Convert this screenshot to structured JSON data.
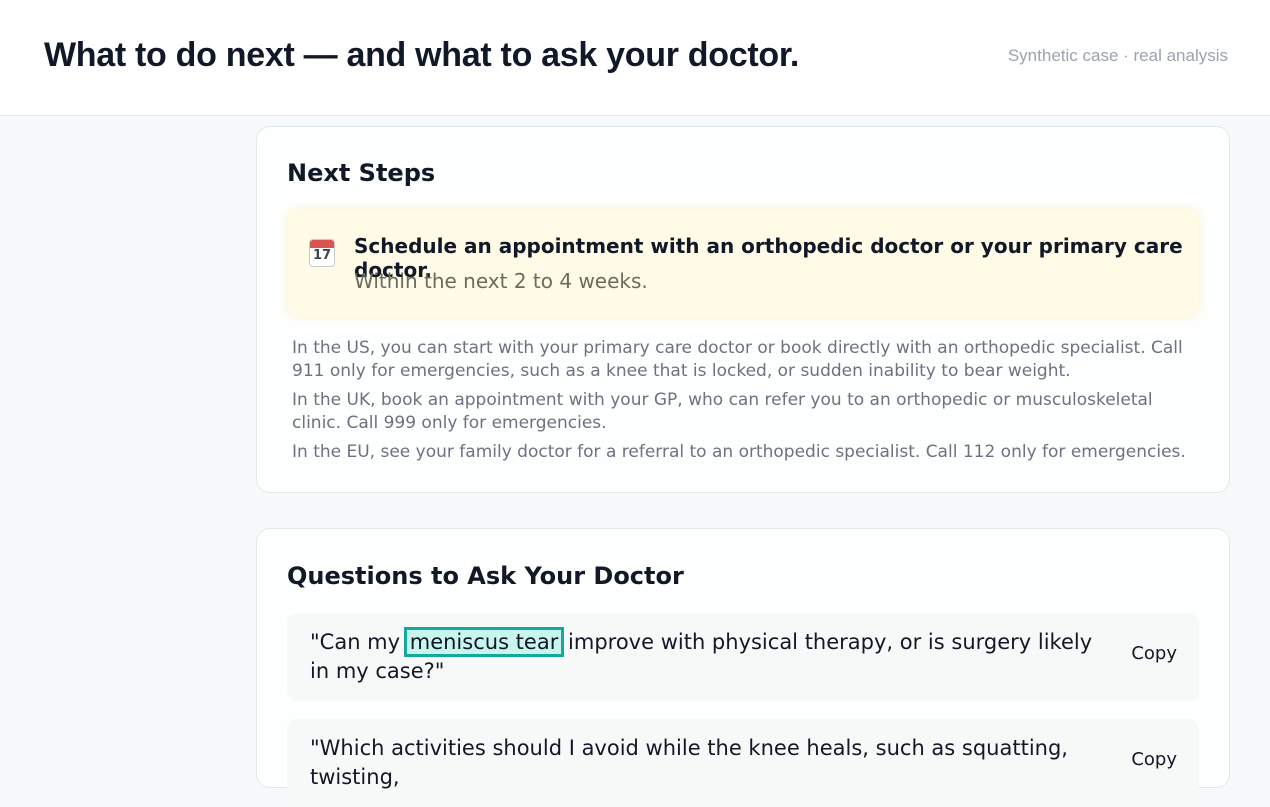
{
  "header": {
    "title": "What to do next — and what to ask your doctor.",
    "meta": "Synthetic case · real analysis"
  },
  "next_steps": {
    "title": "Next Steps",
    "callout": {
      "icon": "calendar-icon",
      "icon_day": "17",
      "title": "Schedule an appointment with an orthopedic doctor or your primary care doctor.",
      "subtitle": "Within the next 2 to 4 weeks."
    },
    "regions": [
      "In the US, you can start with your primary care doctor or book directly with an orthopedic specialist. Call 911 only for emergencies, such as a knee that is locked, or sudden inability to bear weight.",
      "In the UK, book an appointment with your GP, who can refer you to an orthopedic or musculoskeletal clinic. Call 999 only for emergencies.",
      "In the EU, see your family doctor for a referral to an orthopedic specialist. Call 112 only for emergencies."
    ]
  },
  "questions": {
    "title": "Questions to Ask Your Doctor",
    "items": [
      {
        "prefix": "\"Can my",
        "highlight": "meniscus tear",
        "suffix": "improve with physical therapy, or is surgery likely in my case?\"",
        "copy_label": "Copy"
      },
      {
        "prefix": "\"Which activities should I avoid while the knee heals, such as squatting, twisting,",
        "highlight": "",
        "suffix": "",
        "copy_label": "Copy"
      }
    ]
  },
  "colors": {
    "accent": "#14a99b",
    "highlight_bg": "#c8f5ee",
    "callout_bg": "#fffbe7"
  }
}
